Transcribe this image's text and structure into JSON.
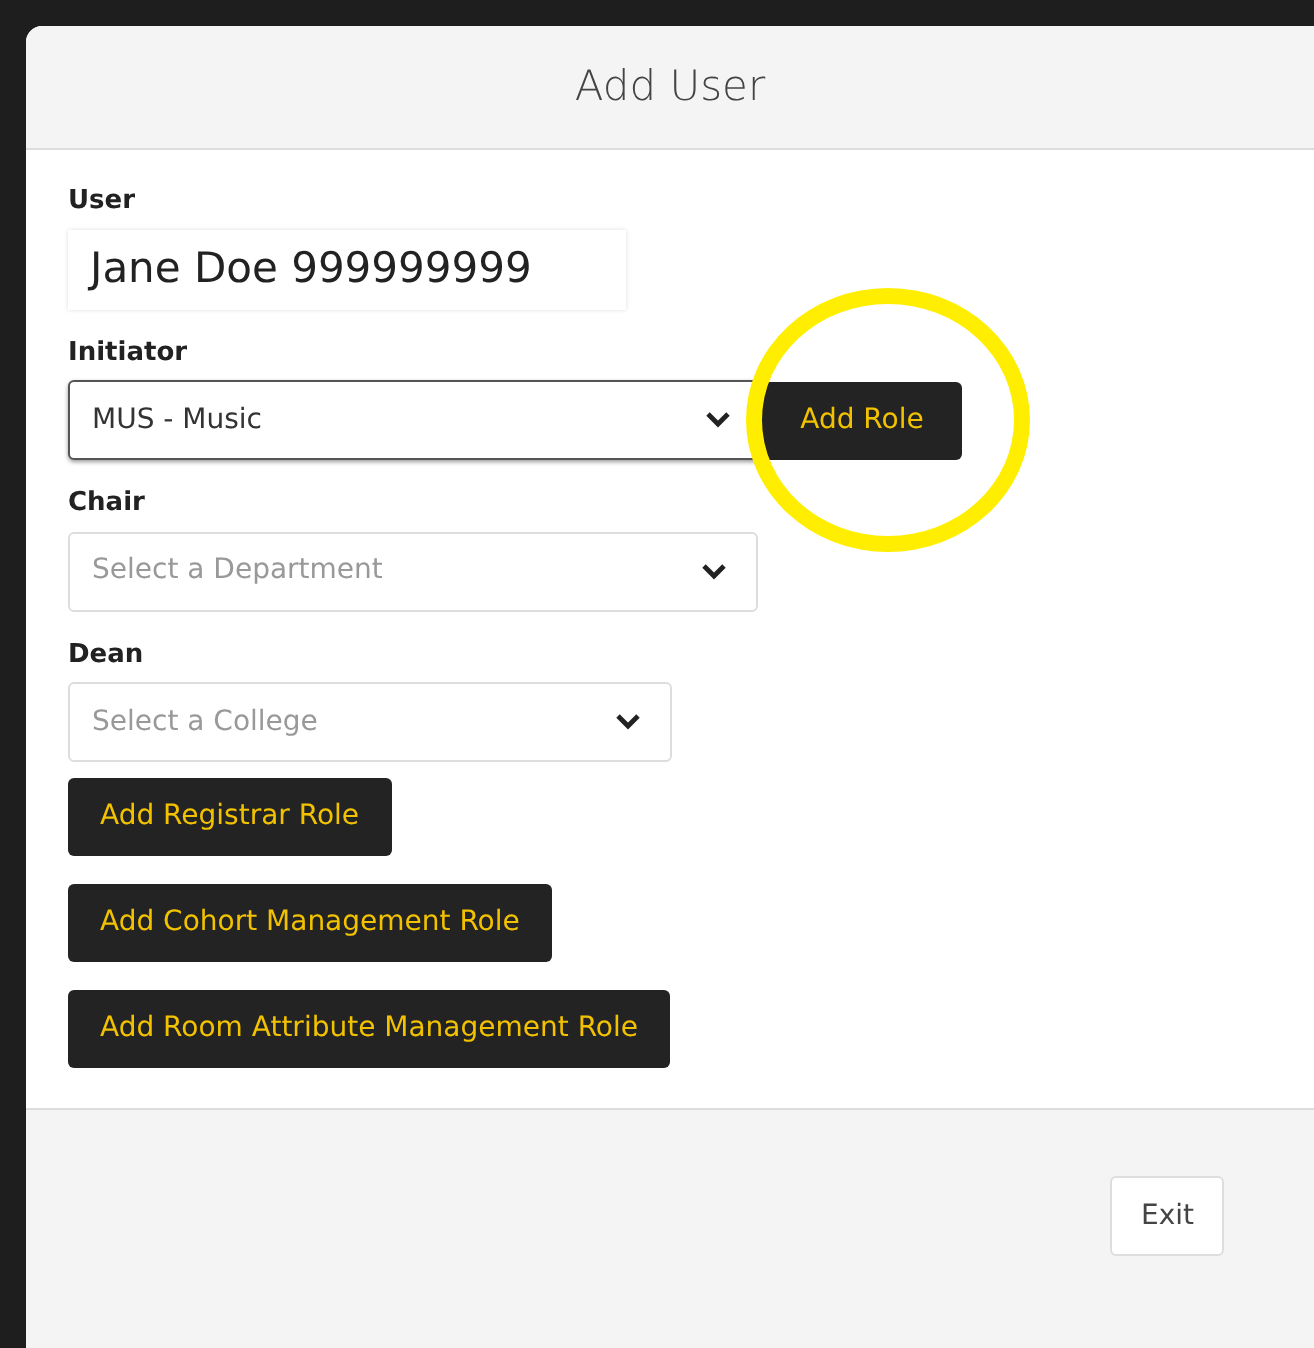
{
  "modal": {
    "title": "Add User"
  },
  "fields": [
    {
      "kind": "text",
      "label": "User",
      "value": "Jane Doe 999999999"
    },
    {
      "kind": "select",
      "label": "Initiator",
      "value": "MUS - Music",
      "focused": true,
      "button": {
        "label": "Add Role",
        "highlighted": true
      }
    },
    {
      "kind": "select",
      "label": "Chair",
      "placeholder": "Select a Department",
      "focused": false
    },
    {
      "kind": "select",
      "label": "Dean",
      "placeholder": "Select a College",
      "focused": false
    }
  ],
  "role_buttons": [
    "Add Registrar Role",
    "Add Cohort Management Role",
    "Add Room Attribute Management Role"
  ],
  "footer": {
    "buttons": [
      "Exit"
    ]
  }
}
